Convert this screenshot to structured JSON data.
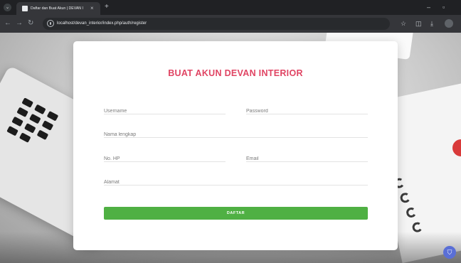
{
  "browser": {
    "tab_title": "Daftar dan Buat Akun | DEVAN I",
    "tab_close": "×",
    "new_tab": "+",
    "url": "localhost/devan_interior/index.php/auth/register",
    "icons": [
      "menu-icon",
      "favicon-icon",
      "back-icon",
      "forward-icon",
      "reload-icon",
      "site-info-icon",
      "star-icon",
      "extensions-icon",
      "download-icon",
      "profile-icon",
      "minimize-icon",
      "maximize-icon"
    ]
  },
  "form": {
    "title": "BUAT AKUN DEVAN INTERIOR",
    "fields": {
      "username": {
        "placeholder": "Username",
        "value": ""
      },
      "password": {
        "placeholder": "Password",
        "value": ""
      },
      "full_name": {
        "placeholder": "Nama lengkap",
        "value": ""
      },
      "phone": {
        "placeholder": "No. HP",
        "value": ""
      },
      "email": {
        "placeholder": "Email",
        "value": ""
      },
      "address": {
        "placeholder": "Alamat",
        "value": ""
      }
    },
    "submit_label": "DAFTAR"
  },
  "colors": {
    "title": "#e04463",
    "submit": "#4fb043",
    "browser_bg": "#202124"
  }
}
